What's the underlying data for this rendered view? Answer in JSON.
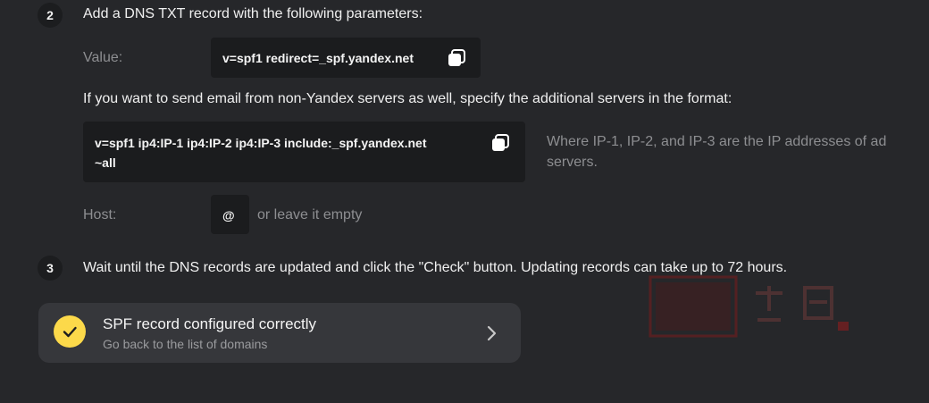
{
  "step2": {
    "number": "2",
    "title": "Add a DNS TXT record with the following parameters:",
    "value_label": "Value:",
    "value": "v=spf1 redirect=_spf.yandex.net",
    "note": "If you want to send email from non-Yandex servers as well, specify the additional servers in the format:",
    "alt_value_line1": "v=spf1 ip4:IP-1 ip4:IP-2 ip4:IP-3 include:_spf.yandex.net",
    "alt_value_line2": "~all",
    "alt_hint_line1": "Where IP-1, IP-2, and IP-3 are the IP addresses of ad",
    "alt_hint_line2": "servers.",
    "host_label": "Host:",
    "host_value": "@",
    "host_alt": "or leave it empty"
  },
  "step3": {
    "number": "3",
    "title": "Wait until the DNS records are updated and click the \"Check\" button. Updating records can take up to 72 hours."
  },
  "status": {
    "title": "SPF record configured correctly",
    "subtitle": "Go back to the list of domains"
  },
  "icons": {
    "copy": "copy-icon",
    "check": "check-icon",
    "chevron": "chevron-right-icon"
  },
  "colors": {
    "background": "#26272a",
    "code_bg": "#1b1c1e",
    "card_bg": "#36373b",
    "check_yellow": "#fcd94a",
    "muted_text": "#8d8e91"
  }
}
